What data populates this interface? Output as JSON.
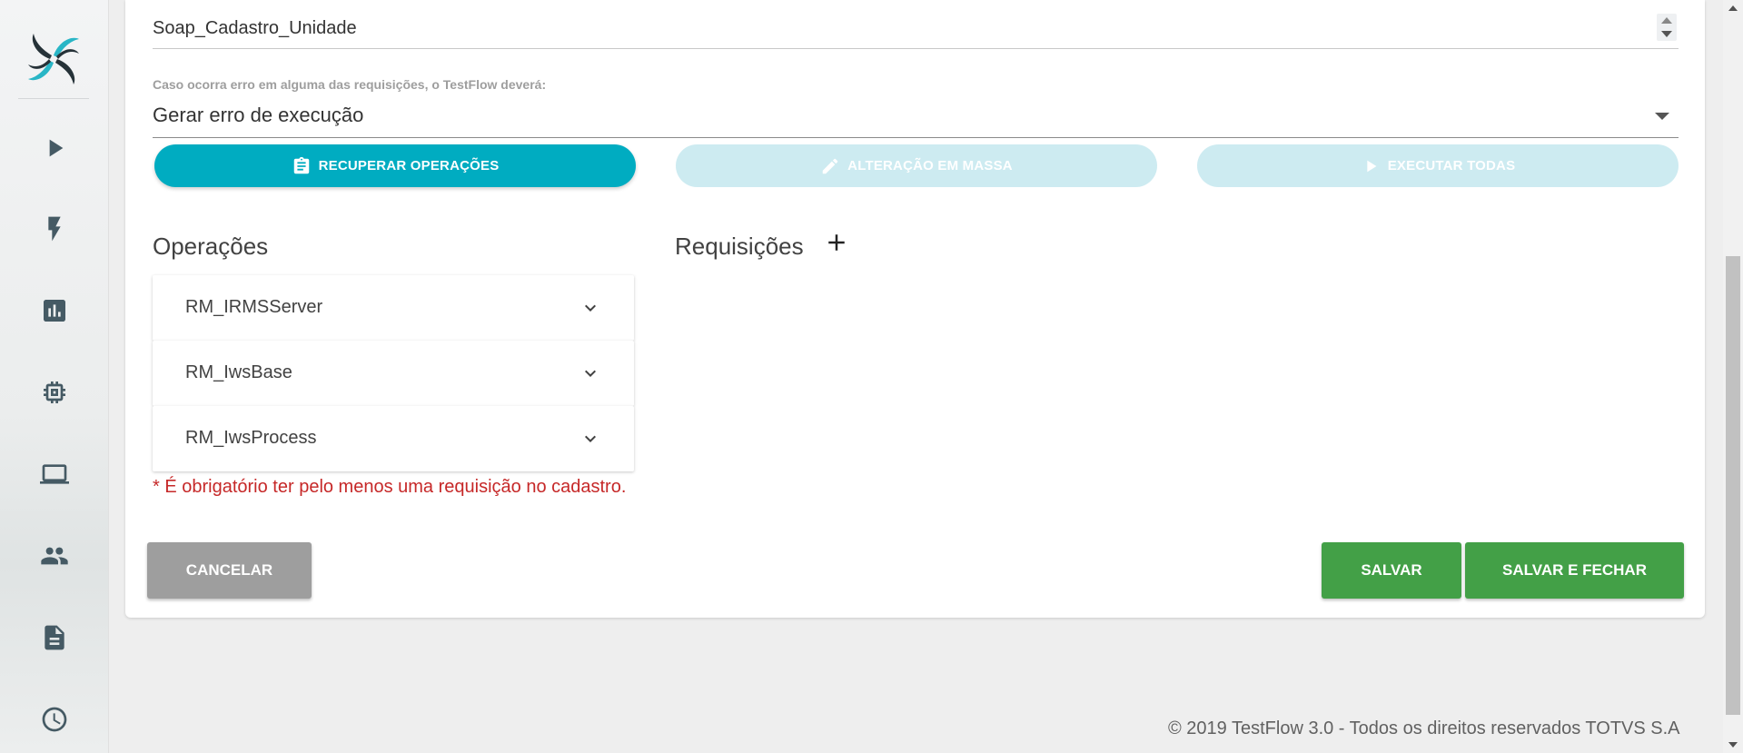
{
  "top_field": {
    "value": "Soap_Cadastro_Unidade"
  },
  "error_policy": {
    "label": "Caso ocorra erro em alguma das requisições, o TestFlow deverá:",
    "value": "Gerar erro de execução"
  },
  "actions": {
    "recover": "RECUPERAR OPERAÇÕES",
    "bulk_edit": "ALTERAÇÃO EM MASSA",
    "run_all": "EXECUTAR TODAS"
  },
  "sections": {
    "operations_title": "Operações",
    "requests_title": "Requisições"
  },
  "operations": [
    {
      "label": "RM_IRMSServer"
    },
    {
      "label": "RM_IwsBase"
    },
    {
      "label": "RM_IwsProcess"
    }
  ],
  "validation_error": "* É obrigatório ter pelo menos uma requisição no cadastro.",
  "buttons": {
    "cancel": "CANCELAR",
    "save": "SALVAR",
    "save_close": "SALVAR E FECHAR"
  },
  "footer": "© 2019 TestFlow 3.0 - Todos os direitos reservados TOTVS S.A",
  "sidebar_icons": [
    "play-icon",
    "bolt-icon",
    "chart-icon",
    "chip-icon",
    "laptop-icon",
    "people-icon",
    "document-icon",
    "clock-icon"
  ],
  "colors": {
    "primary": "#00acc1",
    "primary_disabled": "#cdebf1",
    "success": "#43a047",
    "cancel": "#9e9e9e",
    "error": "#c62828"
  }
}
